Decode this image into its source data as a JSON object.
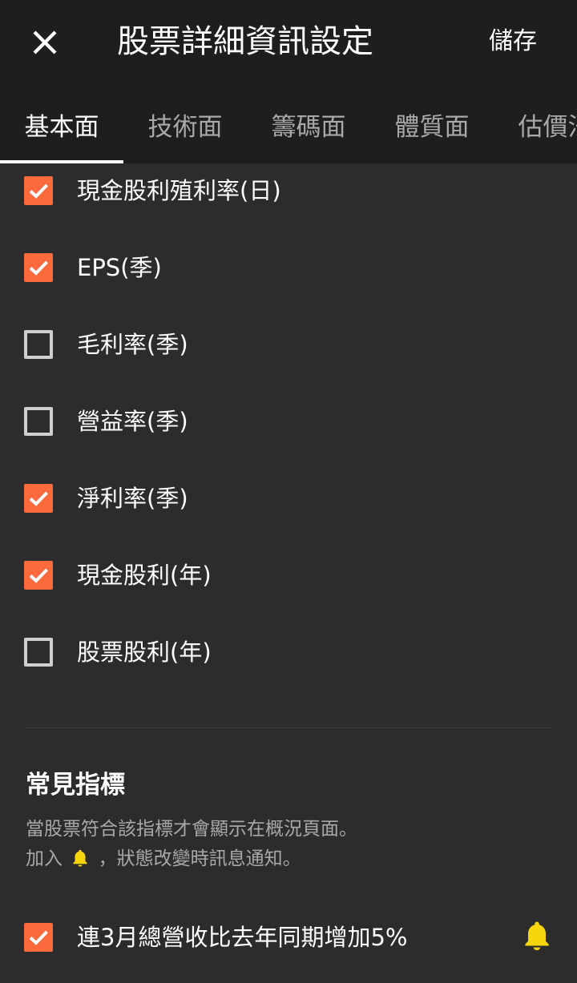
{
  "header": {
    "title": "股票詳細資訊設定",
    "save_label": "儲存"
  },
  "tabs": [
    {
      "label": "基本面",
      "active": true
    },
    {
      "label": "技術面",
      "active": false
    },
    {
      "label": "籌碼面",
      "active": false
    },
    {
      "label": "體質面",
      "active": false
    },
    {
      "label": "估價法",
      "active": false
    }
  ],
  "checklist": [
    {
      "label": "現金股利殖利率(日)",
      "checked": true
    },
    {
      "label": "EPS(季)",
      "checked": true
    },
    {
      "label": "毛利率(季)",
      "checked": false
    },
    {
      "label": "營益率(季)",
      "checked": false
    },
    {
      "label": "淨利率(季)",
      "checked": true
    },
    {
      "label": "現金股利(年)",
      "checked": true
    },
    {
      "label": "股票股利(年)",
      "checked": false
    }
  ],
  "indicators": {
    "title": "常見指標",
    "desc_line1": "當股票符合該指標才會顯示在概況頁面。",
    "desc_line2_prefix": "加入",
    "desc_line2_suffix": "，狀態改變時訊息通知。",
    "items": [
      {
        "label": "連3月總營收比去年同期增加5%",
        "checked": true,
        "alert_icon": "bell-icon"
      }
    ]
  },
  "colors": {
    "accent": "#fa6a3c",
    "bell": "#f5d60c",
    "background": "#2c2c2c",
    "header": "#1e1e1e"
  }
}
